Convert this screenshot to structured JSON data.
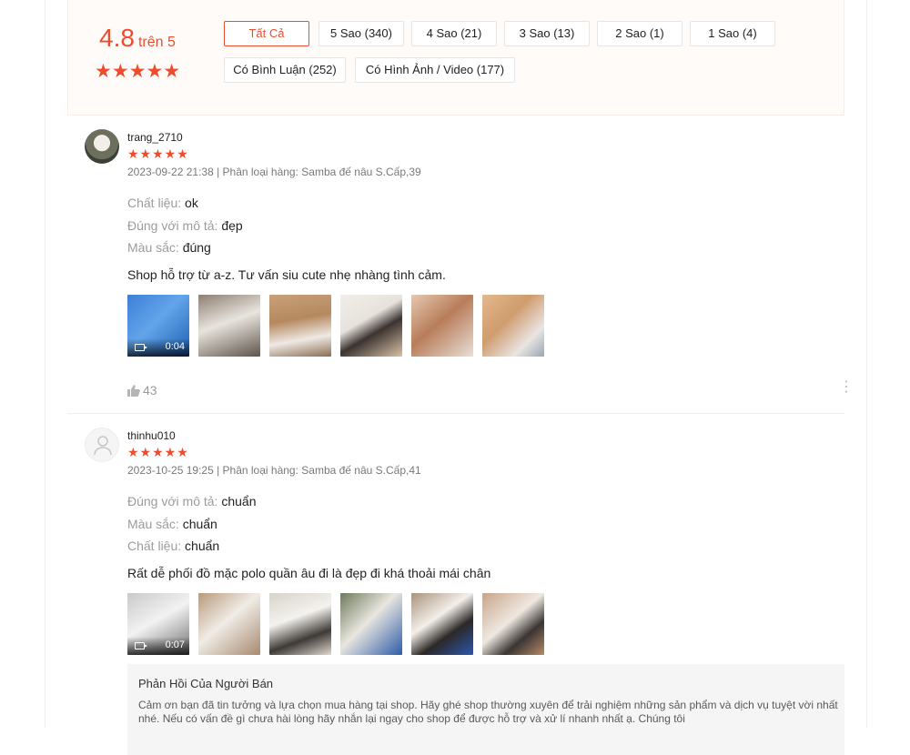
{
  "summary": {
    "score": "4.8",
    "out_of": "trên 5",
    "stars": "★★★★★",
    "filters": [
      {
        "label": "Tất Cả",
        "active": true
      },
      {
        "label": "5 Sao (340)"
      },
      {
        "label": "4 Sao (21)"
      },
      {
        "label": "3 Sao (13)"
      },
      {
        "label": "2 Sao (1)"
      },
      {
        "label": "1 Sao (4)"
      },
      {
        "label": "Có Bình Luận (252)"
      },
      {
        "label": "Có Hình Ảnh / Video (177)"
      }
    ]
  },
  "reviews": [
    {
      "username": "trang_2710",
      "stars": "★★★★★",
      "meta": "2023-09-22 21:38 | Phân loại hàng: Samba đế nâu S.Cấp,39",
      "attributes": [
        {
          "label": "Chất liệu:",
          "value": "ok"
        },
        {
          "label": "Đúng với mô tả:",
          "value": "đẹp"
        },
        {
          "label": "Màu sắc:",
          "value": "đúng"
        }
      ],
      "comment": "Shop hỗ trợ từ a-z. Tư vấn siu cute nhẹ nhàng tình cảm.",
      "video_duration": "0:04",
      "likes": "43"
    },
    {
      "username": "thinhu010",
      "stars": "★★★★★",
      "meta": "2023-10-25 19:25 | Phân loại hàng: Samba đế nâu S.Cấp,41",
      "attributes": [
        {
          "label": "Đúng với mô tả:",
          "value": "chuẩn"
        },
        {
          "label": "Màu sắc:",
          "value": "chuẩn"
        },
        {
          "label": "Chất liệu:",
          "value": "chuẩn"
        }
      ],
      "comment": "Rất dễ phối đồ mặc polo quần âu đi là đẹp đi khá thoải mái chân",
      "video_duration": "0:07",
      "seller_reply": {
        "title": "Phản Hồi Của Người Bán",
        "text": "Cảm ơn bạn đã tin tưởng và lựa chọn mua hàng tại shop. Hãy ghé shop thường xuyên để trải nghiệm những sản phẩm và dịch vụ tuyệt vời nhất nhé. Nếu có vấn đề gì chưa hài lòng hãy nhắn lại ngay cho shop để được hỗ trợ và xử lí nhanh nhất ạ. Chúng tôi"
      }
    }
  ],
  "icons": {
    "like": "thumbs-up-icon",
    "more": "more-vertical-icon",
    "video": "video-camera-icon",
    "avatar": "user-icon"
  }
}
